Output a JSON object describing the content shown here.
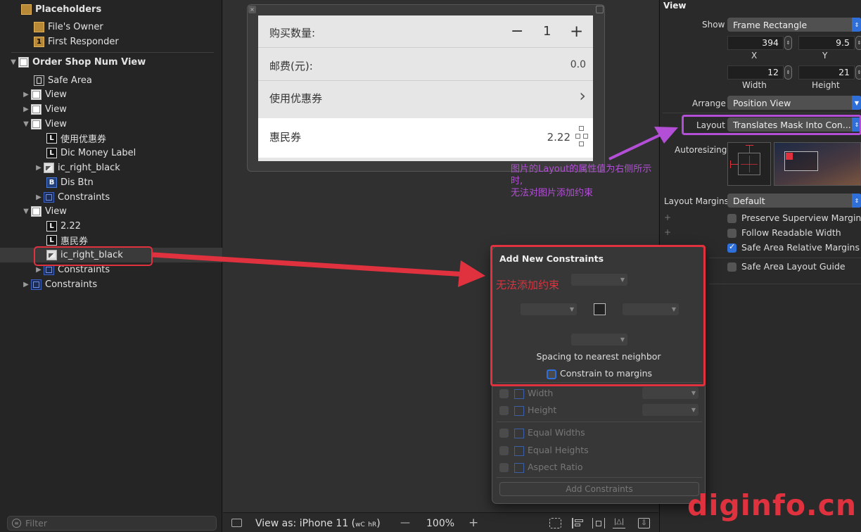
{
  "navigator": {
    "placeholders": "Placeholders",
    "files_owner": "File's Owner",
    "first_responder": "First Responder",
    "root_view": "Order Shop Num View",
    "safe_area": "Safe Area",
    "view1": "View",
    "view2": "View",
    "view3": "View",
    "coupon_label": "使用优惠券",
    "dic_money_label": "Dic Money Label",
    "ic_right_black_1": "ic_right_black",
    "dis_btn": "Dis Btn",
    "constraints_1": "Constraints",
    "view4": "View",
    "value_label": "2.22",
    "huimin_label": "惠民券",
    "ic_right_black_2": "ic_right_black",
    "constraints_2": "Constraints",
    "constraints_3": "Constraints",
    "filter_placeholder": "Filter"
  },
  "canvas": {
    "qty_label": "购买数量:",
    "qty_minus": "−",
    "qty_value": "1",
    "qty_plus": "+",
    "postage_label": "邮费(元):",
    "postage_value": "0.0",
    "coupon_label": "使用优惠券",
    "coupon_chevron": "›",
    "huimin_label": "惠民券",
    "huimin_value": "2.22",
    "annotation_line1": "图片的Layout的属性值为右侧所示时,",
    "annotation_line2": "无法对图片添加约束"
  },
  "bottombar": {
    "view_as": "View as: iPhone 11 (",
    "size_w": "wC",
    "size_h": "hR",
    "close_paren": ")",
    "zoom_minus": "—",
    "zoom": "100%",
    "zoom_plus": "+"
  },
  "inspector": {
    "section": "View",
    "show_label": "Show",
    "show_value": "Frame Rectangle",
    "x_value": "394",
    "x_label": "X",
    "y_value": "9.5",
    "y_label": "Y",
    "width_value": "12",
    "width_label": "Width",
    "height_value": "21",
    "height_label": "Height",
    "arrange_label": "Arrange",
    "arrange_value": "Position View",
    "layout_label": "Layout",
    "layout_value": "Translates Mask Into Con...",
    "autoresizing_label": "Autoresizing",
    "layout_margins_label": "Layout Margins",
    "layout_margins_value": "Default",
    "preserve_superview": "Preserve Superview Margins",
    "follow_readable": "Follow Readable Width",
    "safe_area_relative": "Safe Area Relative Margins",
    "safe_area_guide": "Safe Area Layout Guide"
  },
  "popover": {
    "title": "Add New Constraints",
    "cannot_add": "无法添加约束",
    "spacing": "Spacing to nearest neighbor",
    "constrain_margins": "Constrain to margins",
    "width": "Width",
    "height": "Height",
    "equal_widths": "Equal Widths",
    "equal_heights": "Equal Heights",
    "aspect_ratio": "Aspect Ratio",
    "add_button": "Add Constraints"
  },
  "watermark": "diginfo.cn",
  "colors": {
    "highlight_red": "#e0313e",
    "annotation_purple": "#b24fd6",
    "accent_blue": "#2f6fd9"
  }
}
